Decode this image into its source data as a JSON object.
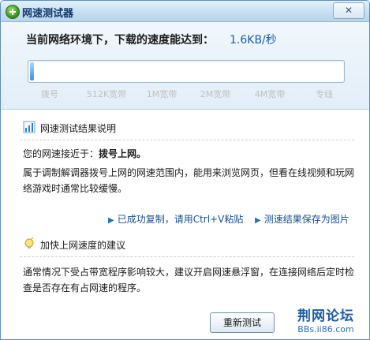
{
  "window": {
    "title": "网速测试器",
    "close_label": "✕"
  },
  "speed": {
    "prefix": "当前网络环境下，下载的速度能达到：",
    "value": "1.6KB/秒",
    "progress_fraction": 0.005,
    "scale": [
      "拨号",
      "512K宽带",
      "1M宽带",
      "2M宽带",
      "4M宽带",
      "专线"
    ]
  },
  "result": {
    "title": "网速测试结果说明",
    "close_to_prefix": "您的网速接近于：",
    "close_to_value": "拨号上网。",
    "desc_line1": "属于调制解调器拨号上网的网速范围内，能用来浏览网页，但看在线视频和玩网",
    "desc_line2": "络游戏时通常比较缓慢。",
    "copy_link": "已成功复制，请用Ctrl+V粘贴",
    "save_link": "测速结果保存为图片"
  },
  "advice": {
    "title": "加快上网速度的建议",
    "line1": "通常情况下受占带宽程序影响较大，建议开启网速悬浮窗，在连接网络后定时检",
    "line2": "查是否存在有占网速的程序。"
  },
  "buttons": {
    "retest": "重新测试"
  },
  "watermark": {
    "main": "荆网论坛",
    "sub": "BBs.ii86.com"
  },
  "colors": {
    "accent": "#1660a8",
    "title_bar": "#c6dff2"
  }
}
